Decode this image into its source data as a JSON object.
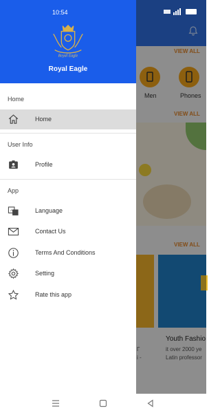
{
  "status_bar": {
    "time": "10:54"
  },
  "drawer": {
    "brand": "Royal Eagle",
    "logo_text": "Royal Eagle",
    "sections": [
      {
        "title": "Home",
        "items": [
          {
            "label": "Home",
            "icon": "home-icon",
            "active": true
          }
        ]
      },
      {
        "title": "User Info",
        "items": [
          {
            "label": "Profile",
            "icon": "profile-icon"
          }
        ]
      },
      {
        "title": "App",
        "items": [
          {
            "label": "Language",
            "icon": "language-icon"
          },
          {
            "label": "Contact Us",
            "icon": "mail-icon"
          },
          {
            "label": "Terms And Conditions",
            "icon": "info-icon"
          },
          {
            "label": "Setting",
            "icon": "gear-icon"
          },
          {
            "label": "Rate this app",
            "icon": "star-icon"
          }
        ]
      }
    ]
  },
  "background": {
    "view_all": "VIEW ALL",
    "categories": [
      "Men",
      "Phones"
    ],
    "card_title": "Youth Fashio",
    "card_text": [
      "it over 2000 ye",
      "Latin professor"
    ],
    "fragments": [
      "Г",
      "i -"
    ]
  },
  "colors": {
    "header": "#1a5dea",
    "app_bar": "#2f6fe0",
    "accent": "#f2a41b"
  }
}
